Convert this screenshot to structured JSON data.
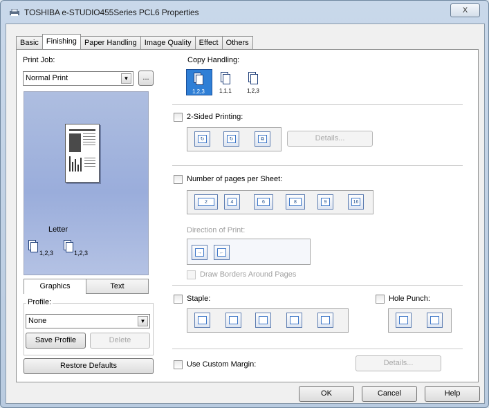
{
  "window": {
    "title": "TOSHIBA e-STUDIO455Series PCL6 Properties",
    "close_glyph": "X"
  },
  "tabs": [
    {
      "label": "Basic"
    },
    {
      "label": "Finishing"
    },
    {
      "label": "Paper Handling"
    },
    {
      "label": "Image Quality"
    },
    {
      "label": "Effect"
    },
    {
      "label": "Others"
    }
  ],
  "active_tab": "Finishing",
  "left": {
    "print_job_label": "Print Job:",
    "print_job_value": "Normal Print",
    "ellipsis": "...",
    "preview_paper_label": "Letter",
    "preview_num_1": "1,2,3",
    "preview_num_2": "1,2,3",
    "seg_graphics": "Graphics",
    "seg_text": "Text",
    "profile_label": "Profile:",
    "profile_value": "None",
    "save_profile": "Save Profile",
    "delete": "Delete",
    "restore_defaults": "Restore Defaults"
  },
  "right": {
    "copy_handling_label": "Copy Handling:",
    "copy_icon_1": "1,2,3",
    "copy_icon_2": "1,1,1",
    "copy_icon_3": "1,2,3",
    "two_sided_label": "2-Sided Printing:",
    "two_sided_details": "Details...",
    "nup_label": "Number of pages per Sheet:",
    "nup_options": [
      "2",
      "4",
      "6",
      "8",
      "9",
      "16"
    ],
    "direction_label": "Direction of Print:",
    "draw_borders_label": "Draw Borders Around Pages",
    "staple_label": "Staple:",
    "hole_punch_label": "Hole Punch:",
    "custom_margin_label": "Use Custom Margin:",
    "custom_margin_details": "Details..."
  },
  "footer": {
    "ok": "OK",
    "cancel": "Cancel",
    "help": "Help"
  },
  "colors": {
    "selected_icon": "#2f7fd6",
    "preview_bg": "#9aaddb",
    "title_bar": "#c9d8ea"
  }
}
